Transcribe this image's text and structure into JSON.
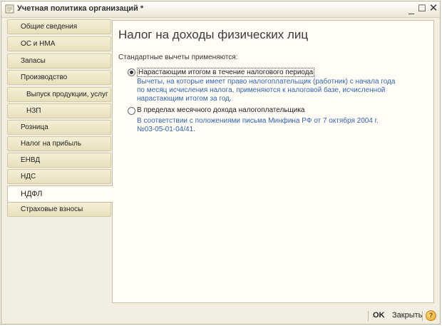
{
  "window": {
    "title": "Учетная политика организаций *",
    "controls": {
      "minimize": "_",
      "maximize": "☐",
      "close": "✕"
    }
  },
  "tabs": [
    {
      "label": "Общие сведения"
    },
    {
      "label": "ОС и НМА"
    },
    {
      "label": "Запасы"
    },
    {
      "label": "Производство"
    },
    {
      "label": "Выпуск продукции, услуг"
    },
    {
      "label": "НЗП"
    },
    {
      "label": "Розница"
    },
    {
      "label": "Налог на прибыль"
    },
    {
      "label": "ЕНВД"
    },
    {
      "label": "НДС"
    },
    {
      "label": "НДФЛ"
    },
    {
      "label": "Страховые взносы"
    }
  ],
  "active_tab": "НДФЛ",
  "content": {
    "title": "Налог на доходы физических лиц",
    "section_label": "Стандартные вычеты применяются:",
    "options": [
      {
        "label": "Нарастающим итогом в течение налогового периода",
        "selected": true,
        "description": [
          "Вычеты, на которые имеет право налогоплательщик (работник) с начала года",
          "по месяц исчисления налога, применяются к налоговой базе, исчисленной",
          "нарастающим итогом за год."
        ]
      },
      {
        "label": "В пределах месячного дохода налогоплательщика",
        "selected": false,
        "description": [
          "В соответствии с положениями письма Минфина РФ от 7 октября 2004 г.",
          "№03-05-01-04/41."
        ]
      }
    ]
  },
  "bottom": {
    "ok_label": "OK",
    "close_label": "Закрыть",
    "help_label": "?"
  },
  "colors": {
    "description_text": "#3264b4",
    "tab_bg": "#ece3c4",
    "panel_bg": "#fffdf6"
  }
}
